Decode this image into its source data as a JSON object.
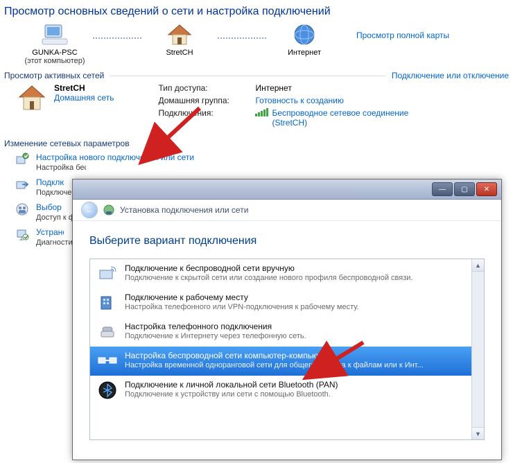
{
  "heading": "Просмотр основных сведений о сети и настройка подключений",
  "map": {
    "pc_label": "GUNKA-PSC",
    "pc_sub": "(этот компьютер)",
    "router_label": "StretCH",
    "internet_label": "Интернет",
    "full_map_link": "Просмотр полной карты"
  },
  "active": {
    "section": "Просмотр активных сетей",
    "toggle_link": "Подключение или отключение",
    "network_name": "StretCH",
    "network_type": "Домашняя сеть",
    "kv": {
      "access_k": "Тип доступа:",
      "access_v": "Интернет",
      "homegroup_k": "Домашняя группа:",
      "homegroup_v": "Готовность к созданию",
      "conn_k": "Подключения:",
      "conn_v": "Беспроводное сетевое соединение (StretCH)"
    }
  },
  "change": {
    "heading": "Изменение сетевых параметров",
    "options": [
      {
        "title": "Настройка нового подключения или сети",
        "desc": "Настройка беспроводного, широкополосного, модемного, прямого или VPN-подключения или же настройка маршрутизатора или точки доступа."
      },
      {
        "title": "Подключиться к сети",
        "desc": "Подключение или повторное подключение к беспроводному, проводному, модемному сетевому соединению или подключение к VPN."
      },
      {
        "title": "Выбор домашней группы и параметров общего доступа",
        "desc": "Доступ к файлам и принтерам, расположенным на других сетевых компьютерах, или изменение параметров общего доступа."
      },
      {
        "title": "Устранение неполадок",
        "desc": "Диагностика и исправление сетевых проблем или получение сведений об исправлении."
      }
    ]
  },
  "dialog": {
    "subhead": "Установка подключения или сети",
    "heading": "Выберите вариант подключения",
    "options": [
      {
        "title": "Подключение к беспроводной сети вручную",
        "desc": "Подключение к скрытой сети или создание нового профиля беспроводной связи."
      },
      {
        "title": "Подключение к рабочему месту",
        "desc": "Настройка телефонного или VPN-подключения к рабочему месту."
      },
      {
        "title": "Настройка телефонного подключения",
        "desc": "Подключение к Интернету через телефонную сеть."
      },
      {
        "title": "Настройка беспроводной сети компьютер-компьютер",
        "desc": "Настройка временной одноранговой сети для общего доступа к файлам или к Инт..."
      },
      {
        "title": "Подключение к личной локальной сети Bluetooth (PAN)",
        "desc": "Подключение к устройству или сети с помощью Bluetooth."
      }
    ]
  },
  "winbtns": {
    "min": "—",
    "max": "▢",
    "close": "✕"
  },
  "colors": {
    "selected": "#1e6fd6",
    "arrow": "#d02121"
  }
}
